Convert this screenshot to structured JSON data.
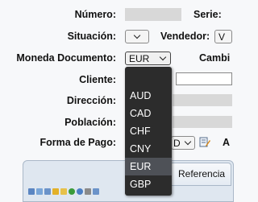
{
  "form": {
    "numero_label": "Número:",
    "serie_label": "Serie:",
    "situacion_label": "Situación:",
    "vendedor_label": "Vendedor:",
    "vendedor_value": "V",
    "moneda_label": "Moneda Documento:",
    "moneda_value": "EUR",
    "cambio_label": "Cambi",
    "cliente_label": "Cliente:",
    "direccion_label": "Dirección:",
    "poblacion_label": "Población:",
    "forma_pago_label": "Forma de Pago:",
    "forma_pago_value": "D",
    "forma_pago_extra": "A"
  },
  "currency_dropdown": {
    "options": [
      "AUD",
      "CAD",
      "CHF",
      "CNY",
      "EUR",
      "GBP"
    ],
    "selected": "EUR"
  },
  "panel": {
    "tab_label": "Referencia"
  },
  "colors": {
    "dropdown_bg": "#2c2c2c",
    "dropdown_selected": "#4e5157",
    "field_gray": "#d8d8d8",
    "panel_bg": "#dfe7f0"
  }
}
